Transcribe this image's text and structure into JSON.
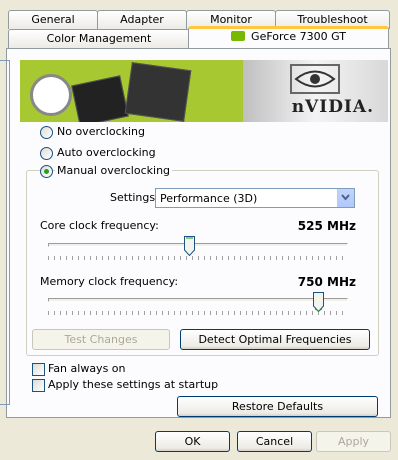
{
  "tabs_row1": [
    "General",
    "Adapter",
    "Monitor",
    "Troubleshoot"
  ],
  "tabs_row2": [
    "Color Management",
    "GeForce 7300 GT"
  ],
  "banner": {
    "brand_text": "nVIDIA."
  },
  "overclock_options": [
    {
      "label": "No overclocking",
      "selected": false
    },
    {
      "label": "Auto overclocking",
      "selected": false
    },
    {
      "label": "Manual overclocking",
      "selected": true
    }
  ],
  "settings": {
    "label": "Settings",
    "value": "Performance (3D)"
  },
  "core": {
    "label": "Core clock frequency:",
    "value": "525 MHz",
    "slider_fraction": 0.47
  },
  "memory": {
    "label": "Memory clock frequency:",
    "value": "750 MHz",
    "slider_fraction": 0.9
  },
  "buttons": {
    "test": "Test Changes",
    "detect": "Detect Optimal Frequencies",
    "restore": "Restore Defaults",
    "ok": "OK",
    "cancel": "Cancel",
    "apply": "Apply"
  },
  "checkboxes": {
    "fan": {
      "label": "Fan always on",
      "checked": false
    },
    "startup": {
      "label": "Apply these settings at startup",
      "checked": false
    }
  },
  "colors": {
    "accent_tab": "#FFC83C",
    "radio_dot": "#21A121",
    "banner_green": "#A8C832"
  }
}
